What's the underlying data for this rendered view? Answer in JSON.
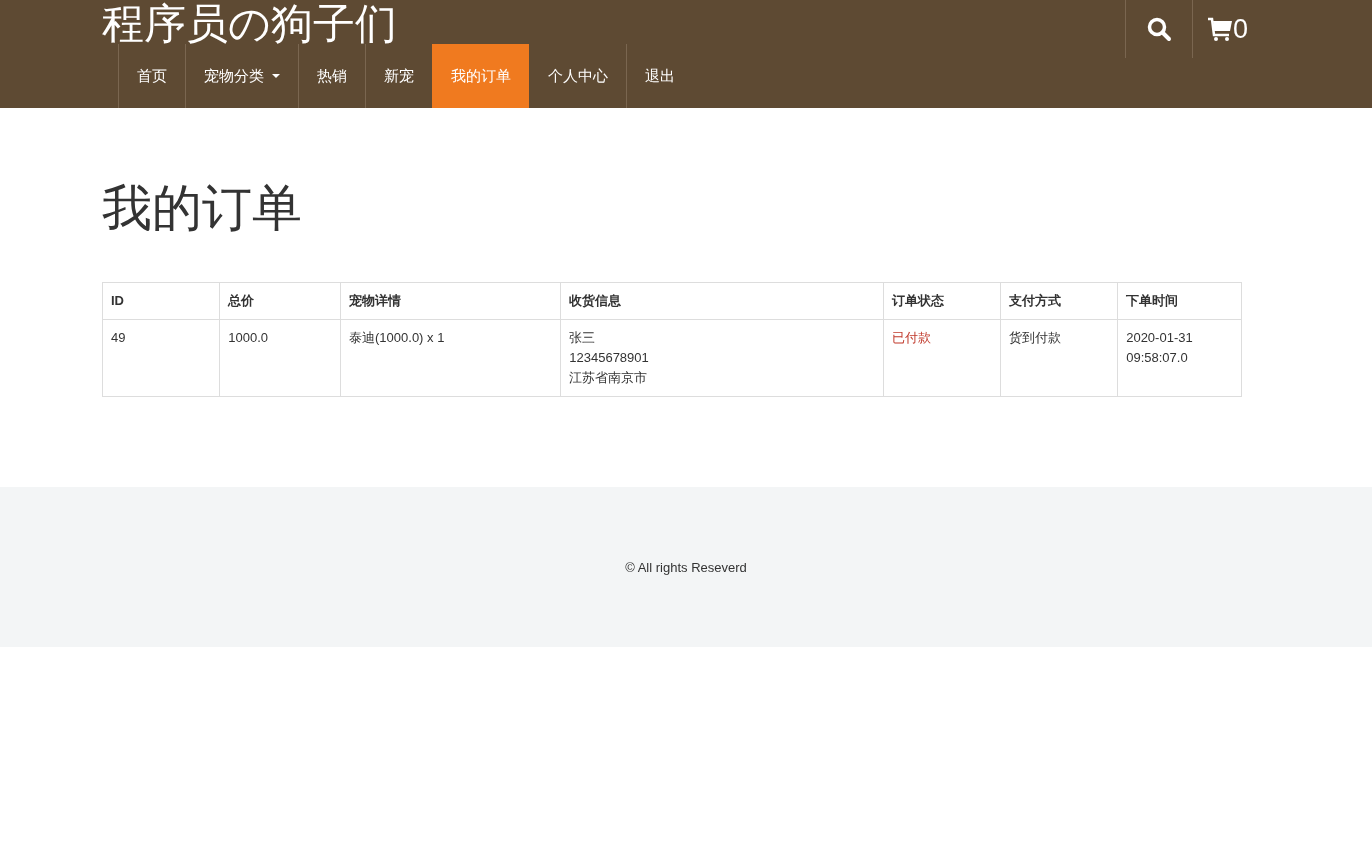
{
  "site": {
    "title": "程序员の狗子们"
  },
  "nav": [
    {
      "label": "首页",
      "kind": "link",
      "selected": false
    },
    {
      "label": "宠物分类",
      "kind": "dropdown",
      "selected": false
    },
    {
      "label": "热销",
      "kind": "link",
      "selected": false
    },
    {
      "label": "新宠",
      "kind": "link",
      "selected": false
    },
    {
      "label": "我的订单",
      "kind": "link",
      "selected": true
    },
    {
      "label": "个人中心",
      "kind": "link",
      "selected": false
    },
    {
      "label": "退出",
      "kind": "link",
      "selected": false
    }
  ],
  "cart": {
    "count": "0"
  },
  "page_title": "我的订单",
  "table": {
    "columns": [
      "ID",
      "总价",
      "宠物详情",
      "收货信息",
      "订单状态",
      "支付方式",
      "下单时间"
    ],
    "rows": [
      {
        "id": "49",
        "total": "1000.0",
        "pets": "泰迪(1000.0) x 1",
        "shipping": [
          "张三",
          "12345678901",
          "江苏省南京市"
        ],
        "status": "已付款",
        "payment": "货到付款",
        "time": [
          "2020-01-31",
          "09:58:07.0"
        ]
      }
    ]
  },
  "footer": {
    "text": "© All rights Reseverd"
  }
}
